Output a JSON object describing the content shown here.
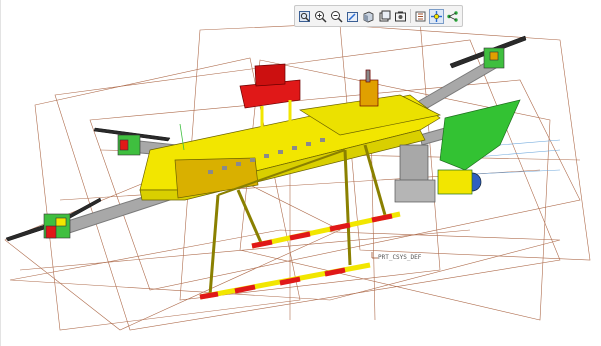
{
  "toolbar": {
    "buttons": [
      {
        "icon": "zoom-fit-icon"
      },
      {
        "icon": "zoom-in-icon"
      },
      {
        "icon": "zoom-out-icon"
      },
      {
        "icon": "repaint-icon"
      },
      {
        "icon": "display-style-icon"
      },
      {
        "icon": "saved-views-icon"
      },
      {
        "icon": "view-manager-icon"
      },
      {
        "icon": "datum-display-icon"
      },
      {
        "icon": "spin-center-icon"
      },
      {
        "icon": "annotation-display-icon"
      }
    ]
  },
  "model": {
    "csys_label": "PRT_CSYS_DEF"
  },
  "colors": {
    "frame_yellow": "#f2e600",
    "motor_green": "#3fbf3f",
    "part_red": "#e01818",
    "datum_brown": "#a0522d",
    "prop_dark": "#2a2a2a",
    "arm_gray": "#a8a8a8",
    "box_orange": "#e0a000"
  }
}
